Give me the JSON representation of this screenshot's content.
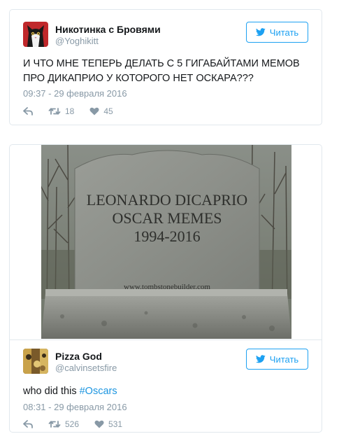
{
  "colors": {
    "accent": "#1da1f2",
    "muted": "#8899a6",
    "text": "#14171a",
    "hashtag": "#1b95e0"
  },
  "tweets": [
    {
      "author": {
        "display_name": "Никотинка с Бровями",
        "handle": "@Yoghikitt",
        "avatar_icon": "cat-avatar"
      },
      "follow_label": "Читать",
      "text": "И ЧТО МНЕ ТЕПЕРЬ ДЕЛАТЬ С 5 ГИГАБАЙТАМИ МЕМОВ ПРО ДИКАПРИО У КОТОРОГО НЕТ ОСКАРА???",
      "timestamp": "09:37 - 29 февраля 2016",
      "retweets": "18",
      "likes": "45"
    },
    {
      "media": {
        "line1": "LEONARDO DICAPRIO",
        "line2": "OSCAR MEMES",
        "line3": "1994-2016",
        "watermark": "www.tombstonebuilder.com"
      },
      "author": {
        "display_name": "Pizza God",
        "handle": "@calvinsetsfire",
        "avatar_icon": "pizza-avatar"
      },
      "follow_label": "Читать",
      "text_plain": "who did this ",
      "hashtag": "#Oscars",
      "timestamp": "08:31 - 29 февраля 2016",
      "retweets": "526",
      "likes": "531"
    }
  ]
}
